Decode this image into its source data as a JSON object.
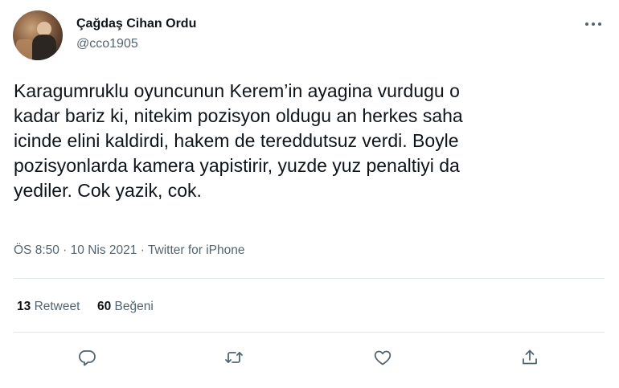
{
  "tweet": {
    "display_name": "Çağdaş Cihan Ordu",
    "handle": "@cco1905",
    "text": "Karagumruklu oyuncunun Kerem’in ayagina vurdugu o\nkadar bariz ki, nitekim pozisyon oldugu an herkes saha\nicinde elini kaldirdi, hakem de tereddutsuz verdi. Boyle\npozisyonlarda kamera yapistirir, yuzde yuz penaltiyi da\nyediler. Cok yazik, cok.",
    "time": "ÖS 8:50",
    "sep1": " · ",
    "date": "10 Nis 2021",
    "sep2": " · ",
    "source": "Twitter for iPhone"
  },
  "stats": {
    "retweet_count": "13",
    "retweet_label": "Retweet",
    "like_count": "60",
    "like_label": "Beğeni"
  },
  "icons": {
    "more": "more-dots-icon",
    "reply": "reply-icon",
    "retweet": "retweet-icon",
    "like": "heart-icon",
    "share": "share-icon"
  },
  "colors": {
    "text": "#0f1419",
    "secondary": "#536471",
    "divider": "#e1e8ed"
  }
}
